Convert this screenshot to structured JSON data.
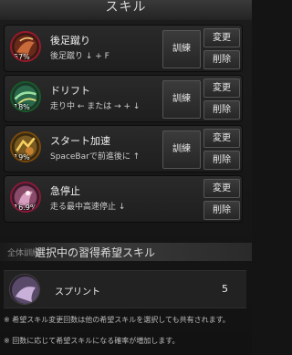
{
  "window": {
    "title": "スキル"
  },
  "skills": [
    {
      "name": "後足蹴り",
      "desc": "後足蹴り ↓ + F",
      "pct": "57%",
      "train": "訓練",
      "change": "変更",
      "delete": "削除",
      "border": "#9a1a2a",
      "art": "fire"
    },
    {
      "name": "ドリフト",
      "desc": "走り中 ← または → + ↓",
      "pct": "18%",
      "train": "訓練",
      "change": "変更",
      "delete": "削除",
      "border": "#1a5a2a",
      "art": "green"
    },
    {
      "name": "スタート加速",
      "desc": "SpaceBarで前進後に ↑",
      "pct": "19%",
      "train": "訓練",
      "change": "変更",
      "delete": "削除",
      "border": "#7a4a0a",
      "art": "gold"
    },
    {
      "name": "急停止",
      "desc": "走る最中高速停止 ↓",
      "pct": "16.9%",
      "change": "変更",
      "delete": "削除",
      "border": "#8a1a3a",
      "art": "pink"
    }
  ],
  "section": {
    "all_train": "全体訓練",
    "title": "選択中の習得希望スキル"
  },
  "wish": {
    "name": "スプリント",
    "count": "5"
  },
  "notes": [
    "※ 希望スキル変更回数は他の希望スキルを選択しても共有されます。",
    "※ 回数に応じて希望スキルになる確率が増加します。"
  ]
}
